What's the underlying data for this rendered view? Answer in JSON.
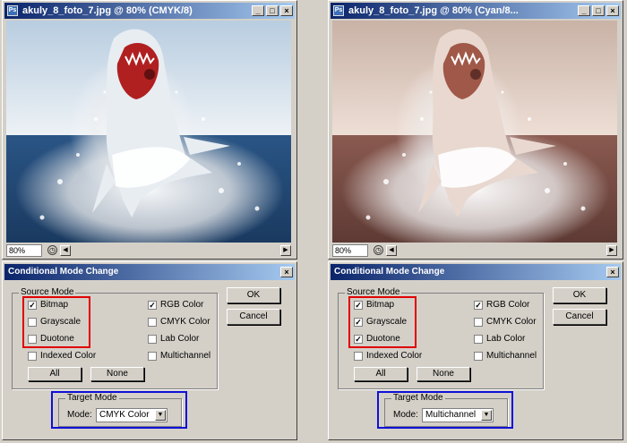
{
  "windows": [
    {
      "title": "akuly_8_foto_7.jpg @ 80% (CMYK/8)",
      "zoom": "80%",
      "photo_tone": "natural",
      "dialog": {
        "title": "Conditional Mode Change",
        "source_mode_label": "Source Mode",
        "checkboxes": [
          {
            "label": "Bitmap",
            "checked": true
          },
          {
            "label": "Grayscale",
            "checked": false
          },
          {
            "label": "Duotone",
            "checked": false
          },
          {
            "label": "Indexed Color",
            "checked": false
          },
          {
            "label": "RGB Color",
            "checked": true
          },
          {
            "label": "CMYK Color",
            "checked": false
          },
          {
            "label": "Lab Color",
            "checked": false
          },
          {
            "label": "Multichannel",
            "checked": false
          }
        ],
        "all_label": "All",
        "none_label": "None",
        "ok_label": "OK",
        "cancel_label": "Cancel",
        "target_mode_label": "Target Mode",
        "mode_label": "Mode:",
        "mode_value": "CMYK Color"
      }
    },
    {
      "title": "akuly_8_foto_7.jpg @ 80% (Cyan/8...",
      "zoom": "80%",
      "photo_tone": "sepia",
      "dialog": {
        "title": "Conditional Mode Change",
        "source_mode_label": "Source Mode",
        "checkboxes": [
          {
            "label": "Bitmap",
            "checked": true
          },
          {
            "label": "Grayscale",
            "checked": true
          },
          {
            "label": "Duotone",
            "checked": true
          },
          {
            "label": "Indexed Color",
            "checked": false
          },
          {
            "label": "RGB Color",
            "checked": true
          },
          {
            "label": "CMYK Color",
            "checked": false
          },
          {
            "label": "Lab Color",
            "checked": false
          },
          {
            "label": "Multichannel",
            "checked": false
          }
        ],
        "all_label": "All",
        "none_label": "None",
        "ok_label": "OK",
        "cancel_label": "Cancel",
        "target_mode_label": "Target Mode",
        "mode_label": "Mode:",
        "mode_value": "Multichannel"
      }
    }
  ],
  "colors": {
    "highlight_red": "#e00000",
    "highlight_blue": "#1010d8",
    "titlebar": "#0a246a"
  }
}
